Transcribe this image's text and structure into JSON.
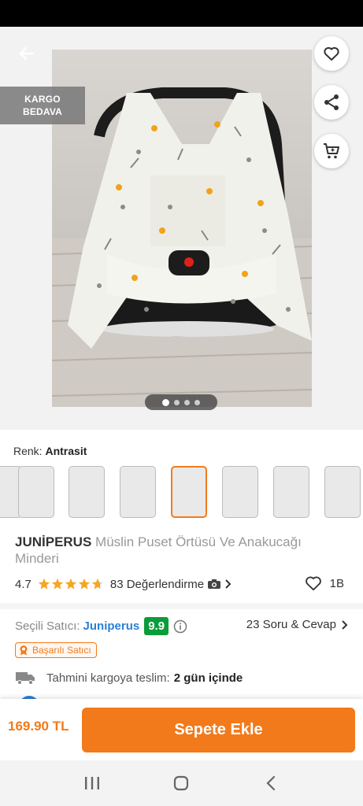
{
  "hero": {
    "cargo_badge_line1": "KARGO",
    "cargo_badge_line2": "BEDAVA",
    "carousel_total": 4,
    "carousel_active": 1
  },
  "color": {
    "label": "Renk:",
    "value": "Antrasit",
    "variant_count": 8,
    "selected_index": 4
  },
  "product": {
    "brand": "JUNİPERUS",
    "name": "Müslin Puset Örtüsü Ve Anakucağı Minderi"
  },
  "rating": {
    "score": "4.7",
    "stars": 4.7,
    "reviews_text": "83 Değerlendirme",
    "likes": "1B"
  },
  "seller": {
    "label": "Seçili Satıcı:",
    "name": "Juniperus",
    "score": "9.9",
    "qa": "23 Soru & Cevap",
    "badge": "Başarılı Satıcı"
  },
  "shipping": {
    "label": "Tahmini kargoya teslim:",
    "value": "2 gün içinde"
  },
  "cart": {
    "price": "169.90 TL",
    "button": "Sepete Ekle"
  },
  "colors": {
    "accent": "#f27a1a",
    "link": "#2b7fd3",
    "score_bg": "#0a9c3a"
  }
}
